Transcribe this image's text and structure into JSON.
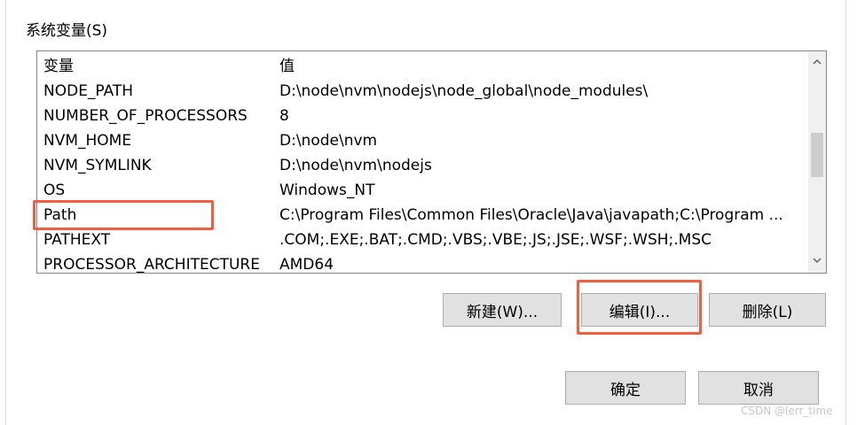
{
  "section_label": "系统变量(S)",
  "table": {
    "headers": [
      "变量",
      "值"
    ],
    "rows": [
      {
        "name": "NODE_PATH",
        "value": "D:\\node\\nvm\\nodejs\\node_global\\node_modules\\"
      },
      {
        "name": "NUMBER_OF_PROCESSORS",
        "value": "8"
      },
      {
        "name": "NVM_HOME",
        "value": "D:\\node\\nvm"
      },
      {
        "name": "NVM_SYMLINK",
        "value": "D:\\node\\nvm\\nodejs"
      },
      {
        "name": "OS",
        "value": "Windows_NT"
      },
      {
        "name": "Path",
        "value": "C:\\Program Files\\Common Files\\Oracle\\Java\\javapath;C:\\Program ..."
      },
      {
        "name": "PATHEXT",
        "value": ".COM;.EXE;.BAT;.CMD;.VBS;.VBE;.JS;.JSE;.WSF;.WSH;.MSC"
      },
      {
        "name": "PROCESSOR_ARCHITECTURE",
        "value": "AMD64"
      }
    ],
    "selected_row": "Path"
  },
  "scroll_up_glyph": "^",
  "scroll_down_glyph": "v",
  "buttons": {
    "new": "新建(W)...",
    "edit": "编辑(I)...",
    "delete": "删除(L)",
    "ok": "确定",
    "cancel": "取消"
  },
  "highlight_color": "#f06040",
  "watermark": "CSDN @lerr_time"
}
